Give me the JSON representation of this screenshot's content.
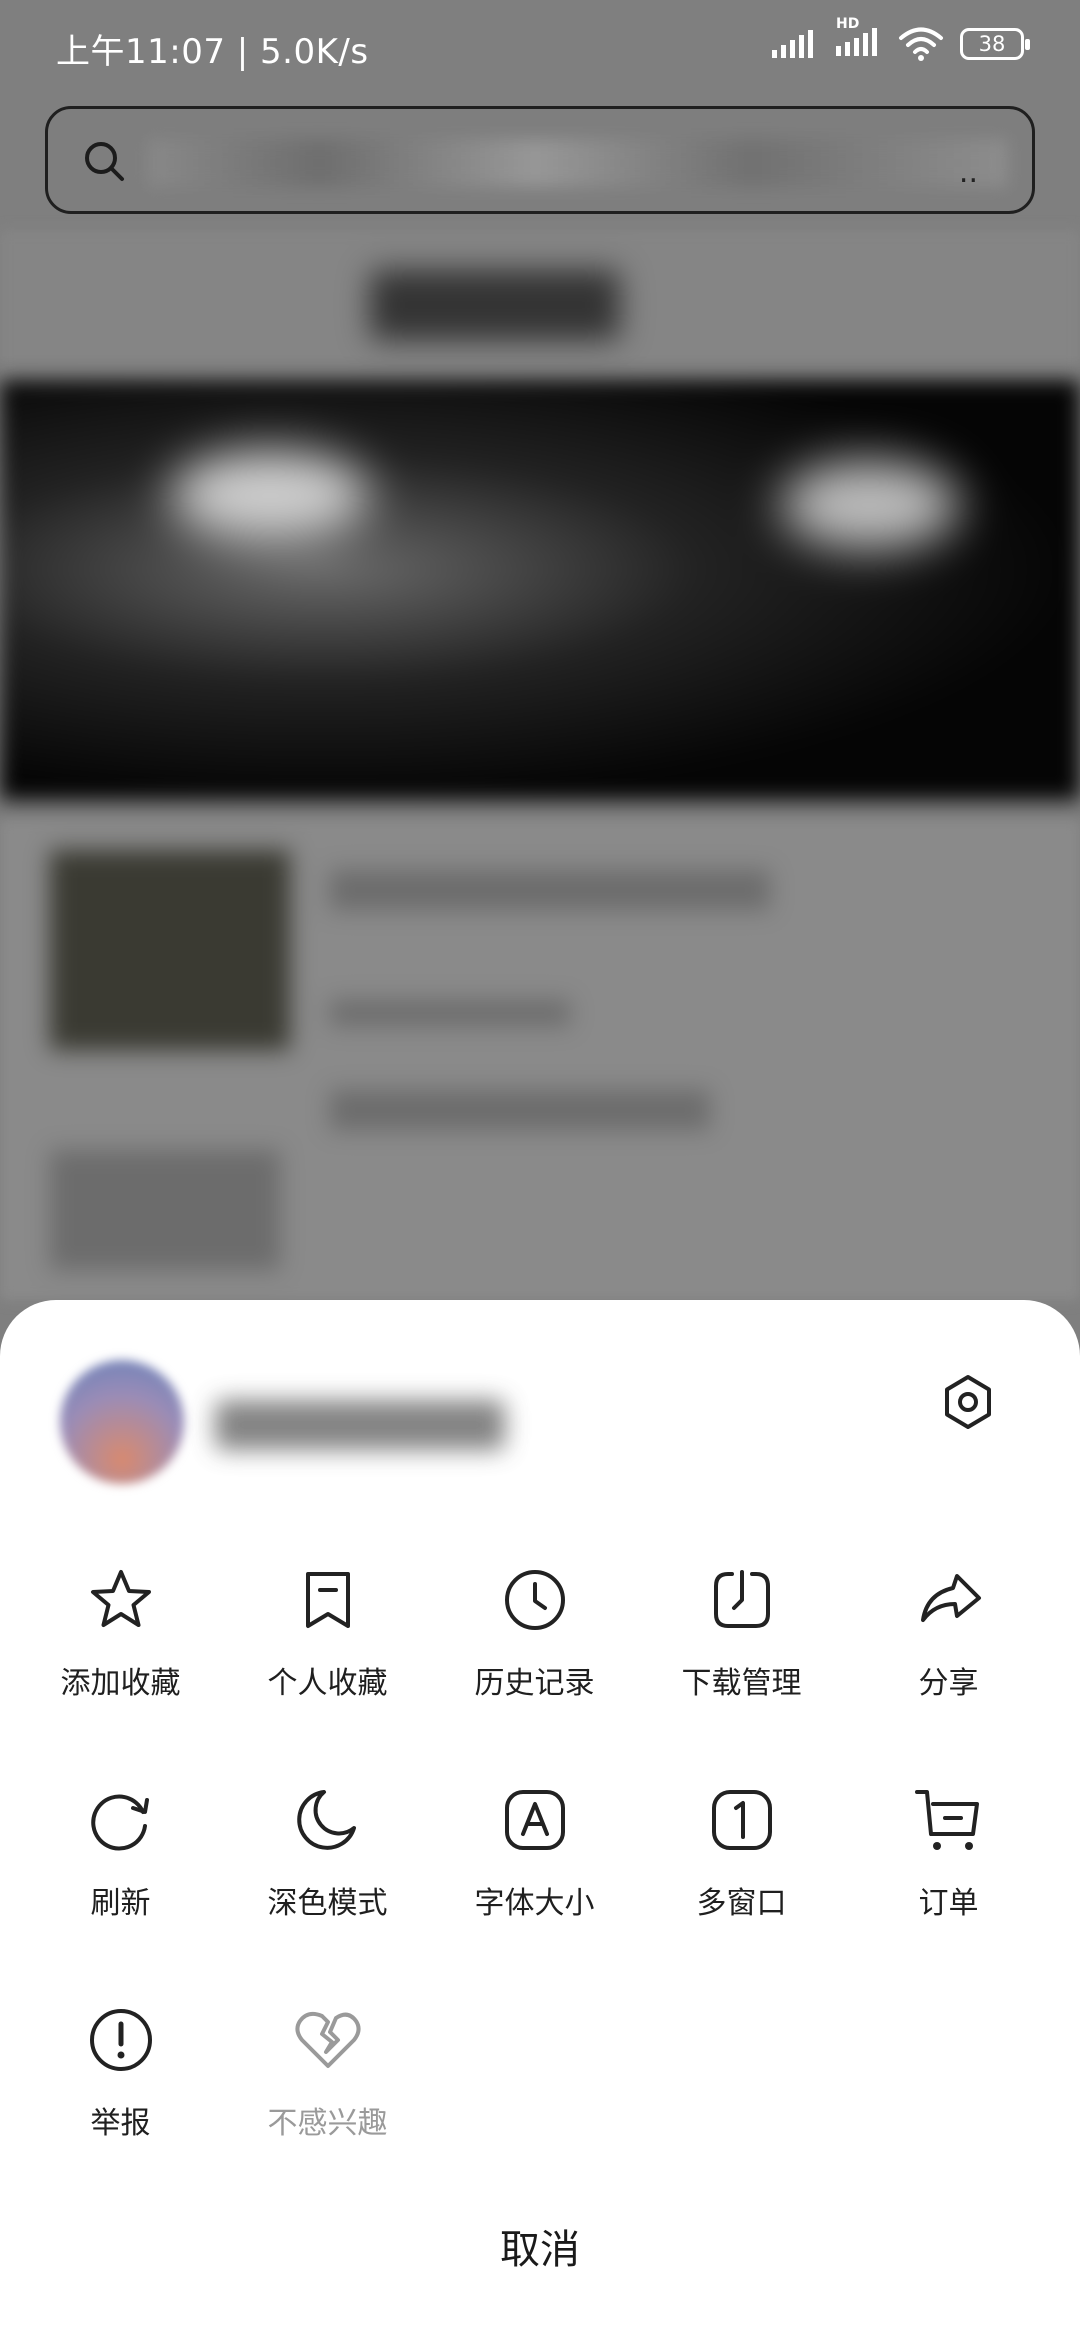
{
  "status_bar": {
    "time_and_speed": "上午11:07 | 5.0K/s",
    "network_badge": "HD",
    "battery": "38"
  },
  "search": {
    "ellipsis": ".."
  },
  "menu": {
    "items": [
      {
        "label": "添加收藏",
        "icon": "star-icon"
      },
      {
        "label": "个人收藏",
        "icon": "bookmark-icon"
      },
      {
        "label": "历史记录",
        "icon": "clock-icon"
      },
      {
        "label": "下载管理",
        "icon": "download-icon"
      },
      {
        "label": "分享",
        "icon": "share-icon"
      },
      {
        "label": "刷新",
        "icon": "refresh-icon"
      },
      {
        "label": "深色模式",
        "icon": "moon-icon"
      },
      {
        "label": "字体大小",
        "icon": "font-size-icon"
      },
      {
        "label": "多窗口",
        "icon": "multi-window-icon"
      },
      {
        "label": "订单",
        "icon": "cart-icon"
      },
      {
        "label": "举报",
        "icon": "report-icon"
      },
      {
        "label": "不感兴趣",
        "icon": "broken-heart-icon",
        "disabled": true
      }
    ],
    "cancel_label": "取消"
  },
  "colors": {
    "overlay": "#7f7f7f",
    "sheet": "#ffffff",
    "icon_stroke": "#222222",
    "disabled_text": "#9a9a9a"
  }
}
